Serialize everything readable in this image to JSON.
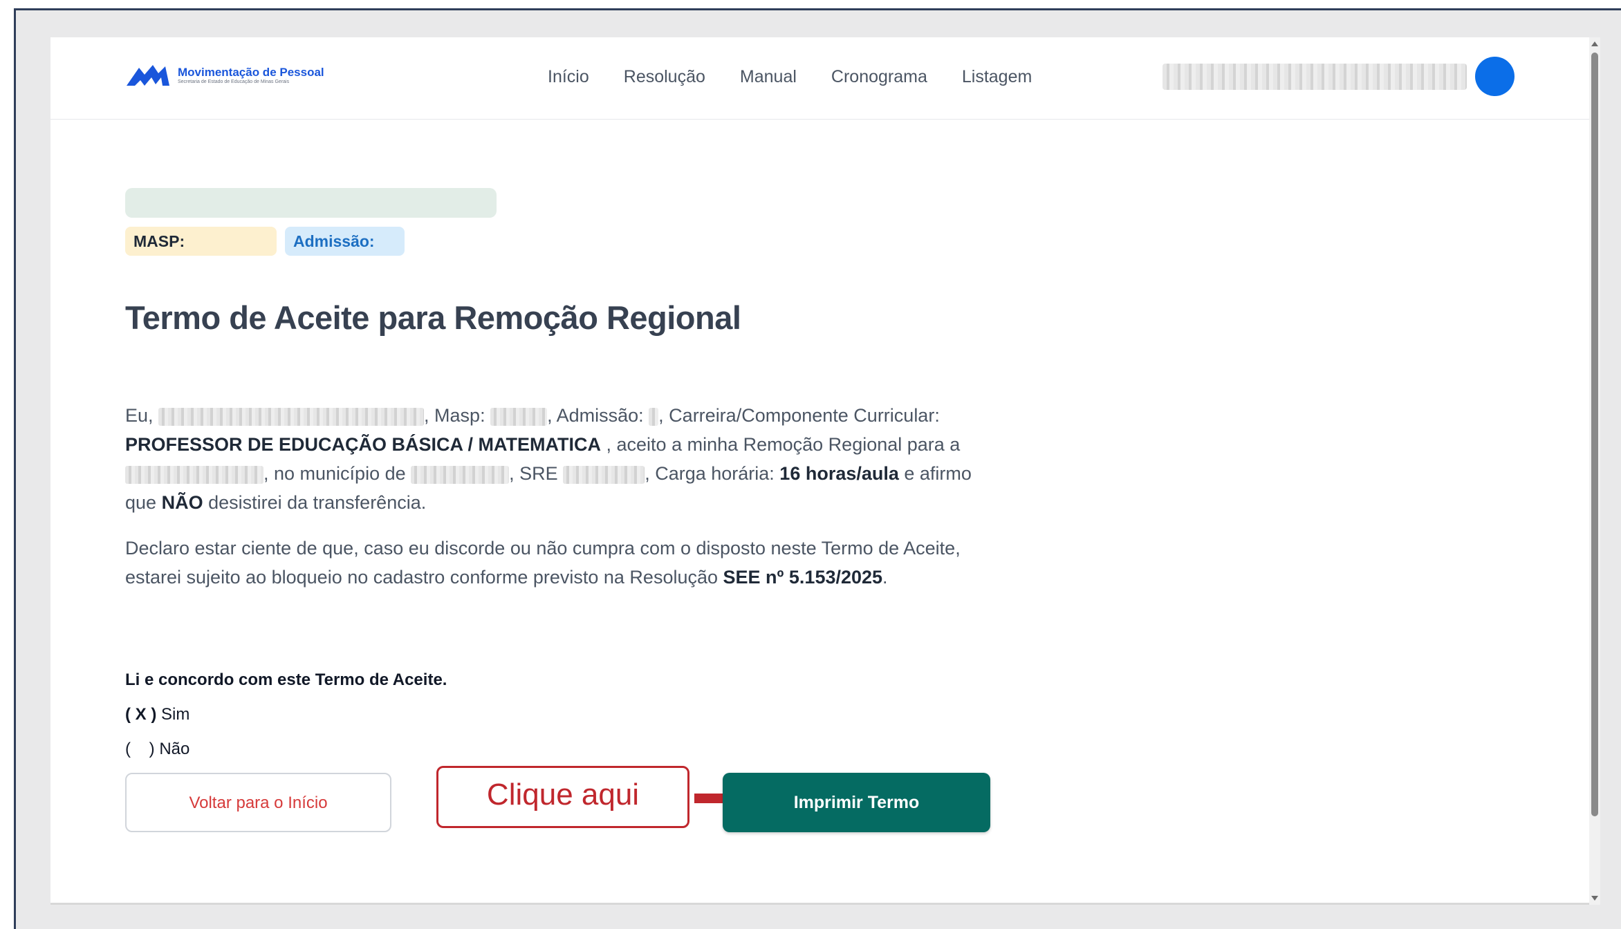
{
  "app": {
    "logo_title": "Movimentação de Pessoal",
    "logo_subtitle": "Secretaria de Estado de Educação de Minas Gerais"
  },
  "nav": {
    "items": [
      {
        "label": "Início"
      },
      {
        "label": "Resolução"
      },
      {
        "label": "Manual"
      },
      {
        "label": "Cronograma"
      },
      {
        "label": "Listagem"
      }
    ]
  },
  "profile": {
    "masp_label": "MASP:",
    "admissao_label": "Admissão:"
  },
  "term": {
    "title": "Termo de Aceite para Remoção Regional",
    "p1_eu": "Eu,",
    "p1_masp": ", Masp:",
    "p1_admissao": ", Admissão:",
    "p1_carreira": ", Carreira/Componente Curricular:",
    "p1_carreira_value": "PROFESSOR DE EDUCAÇÃO BÁSICA / MATEMATICA",
    "p1_aceito": " , aceito a minha Remoção Regional para a",
    "p1_municipio": ", no município de",
    "p1_sre": ", SRE",
    "p1_carga": ", Carga horária:",
    "p1_carga_value": "16 horas/aula",
    "p1_afirmo": " e afirmo que",
    "p1_nao": "NÃO",
    "p1_desisti": " desistirei da transferência.",
    "p2_text": "Declaro estar ciente de que, caso eu discorde ou não cumpra com o disposto neste Termo de Aceite, estarei sujeito ao bloqueio no cadastro conforme previsto na Resolução",
    "p2_resolucao": "SEE nº 5.153/2025",
    "p2_end": "."
  },
  "agreement": {
    "title": "Li e concordo com este Termo de Aceite.",
    "yes_mark": "( X )",
    "yes_label": " Sim",
    "no_mark": "(    )",
    "no_label": " Não"
  },
  "actions": {
    "back_label": "Voltar para o Início",
    "callout_label": "Clique aqui",
    "print_label": "Imprimir Termo"
  },
  "colors": {
    "primary": "#056b62",
    "brand": "#1a56db",
    "callout": "#c0272d",
    "avatar": "#0b6ee8"
  }
}
